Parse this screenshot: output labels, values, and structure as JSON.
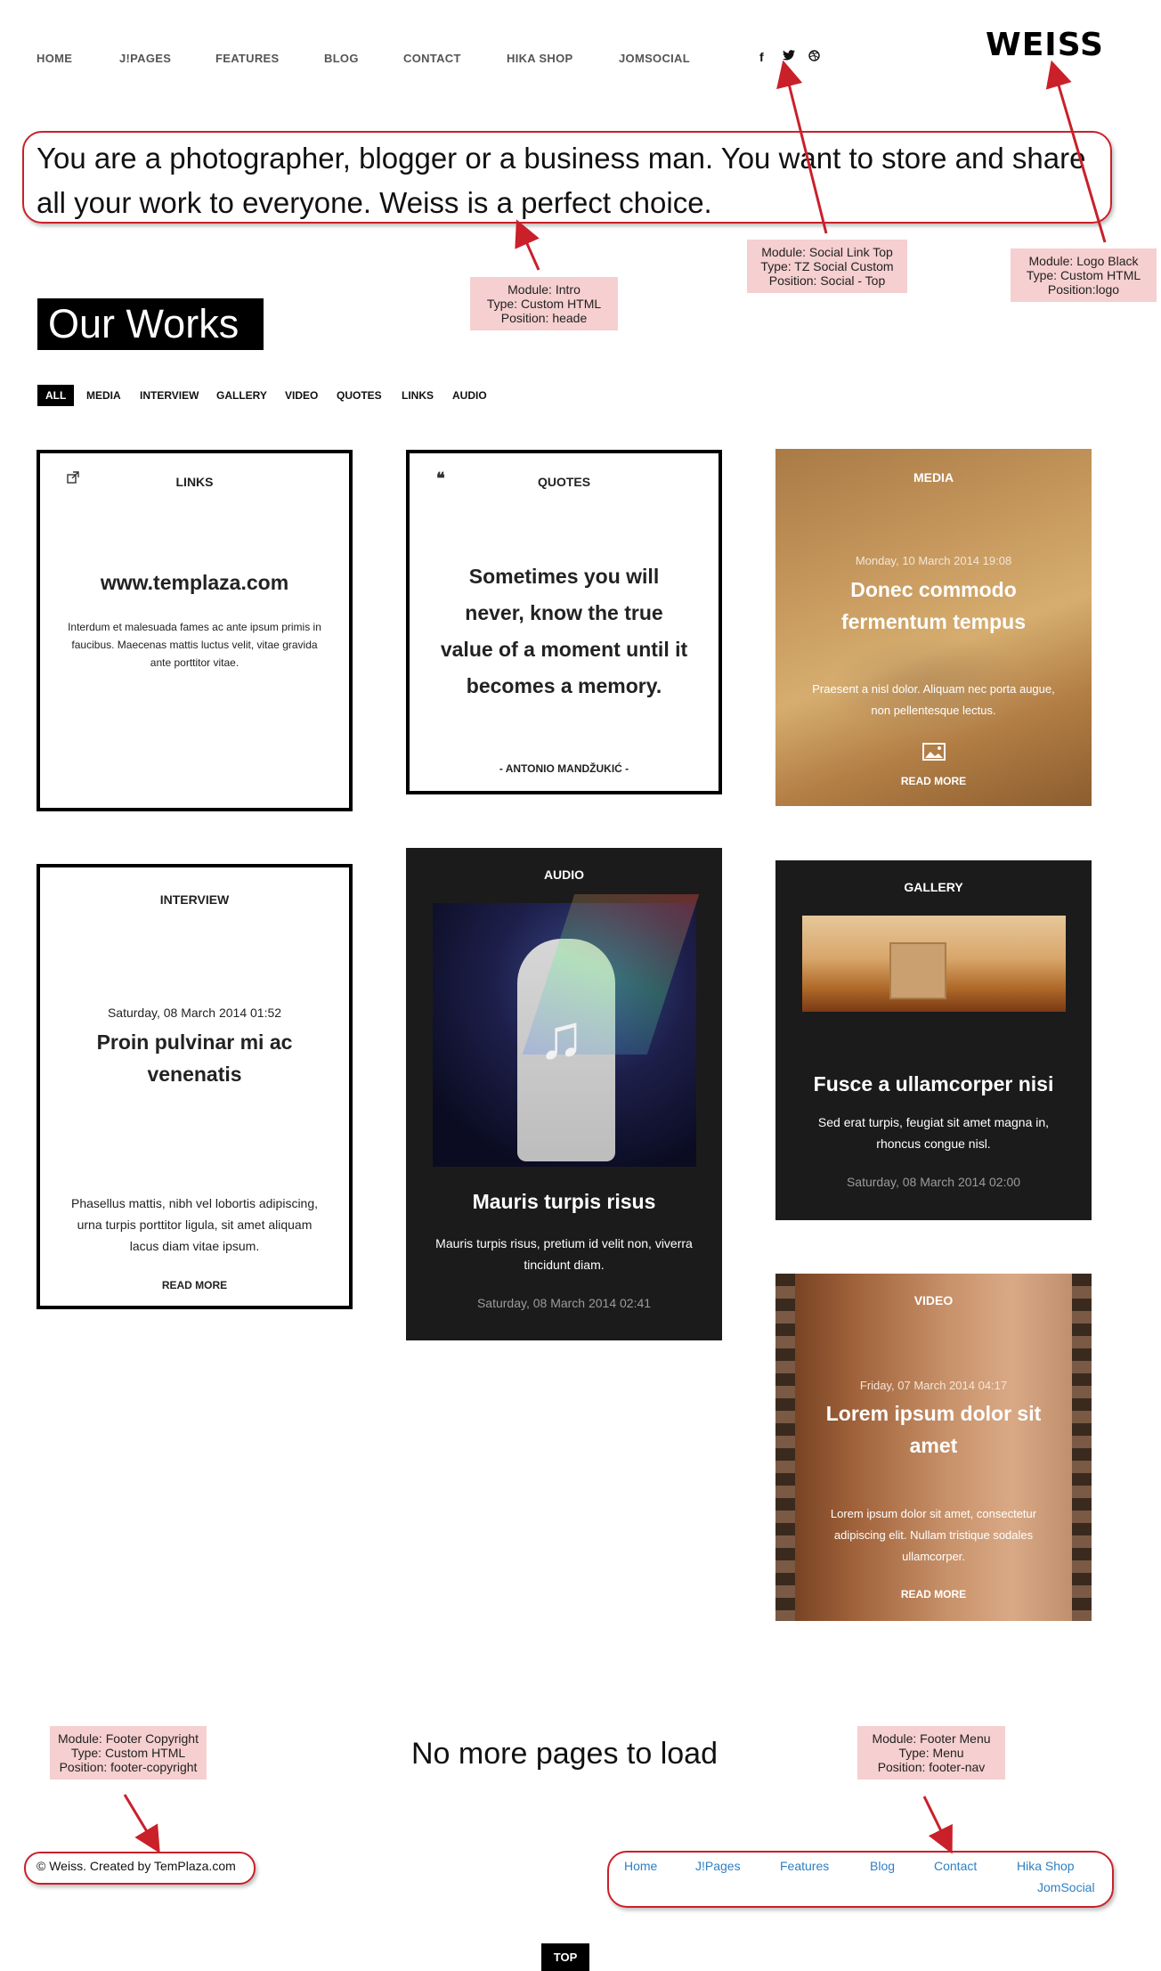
{
  "nav": {
    "items": [
      "HOME",
      "J!PAGES",
      "FEATURES",
      "BLOG",
      "CONTACT",
      "HIKA SHOP",
      "JOMSOCIAL"
    ]
  },
  "social": {
    "facebook": "f",
    "twitter": "🐦",
    "dribbble": "◎"
  },
  "logo": "WEISS",
  "intro": {
    "text": "You are a photographer, blogger or a business man. You want to store and share all your work to everyone. Weiss is a perfect choice."
  },
  "annotations": {
    "intro": [
      "Module: Intro",
      "Type: Custom HTML",
      "Position: heade"
    ],
    "social": [
      "Module: Social Link Top",
      "Type: TZ Social Custom",
      "Position: Social - Top"
    ],
    "logo": [
      "Module: Logo Black",
      "Type: Custom HTML",
      "Position:logo"
    ],
    "footer_copyright": [
      "Module: Footer Copyright",
      "Type: Custom HTML",
      "Position: footer-copyright"
    ],
    "footer_menu": [
      "Module: Footer Menu",
      "Type: Menu",
      "Position: footer-nav"
    ]
  },
  "works": {
    "title": "Our Works",
    "filters": [
      "ALL",
      "MEDIA",
      "INTERVIEW",
      "GALLERY",
      "VIDEO",
      "QUOTES",
      "LINKS",
      "AUDIO"
    ]
  },
  "cards": {
    "links": {
      "label": "LINKS",
      "url": "www.templaza.com",
      "text": "Interdum et malesuada fames ac ante ipsum primis in faucibus. Maecenas mattis luctus velit, vitae gravida ante porttitor vitae."
    },
    "quotes": {
      "label": "QUOTES",
      "quote": "Sometimes you will never, know the true value of a moment until it becomes a memory.",
      "author": "- ANTONIO MANDŽUKIĆ -"
    },
    "media": {
      "label": "MEDIA",
      "date": "Monday, 10 March 2014 19:08",
      "title": "Donec commodo fermentum tempus",
      "text": "Praesent a nisl dolor. Aliquam nec porta augue, non pellentesque lectus.",
      "readmore": "READ MORE"
    },
    "interview": {
      "label": "INTERVIEW",
      "date": "Saturday, 08 March 2014 01:52",
      "title": "Proin pulvinar mi ac venenatis",
      "text": "Phasellus mattis, nibh vel lobortis adipiscing, urna turpis porttitor ligula, sit amet aliquam lacus diam vitae ipsum.",
      "readmore": "READ MORE"
    },
    "audio": {
      "label": "AUDIO",
      "title": "Mauris turpis risus",
      "text": "Mauris turpis risus, pretium id velit non, viverra tincidunt diam.",
      "date": "Saturday, 08 March 2014 02:41"
    },
    "gallery": {
      "label": "GALLERY",
      "title": "Fusce a ullamcorper nisi",
      "text": "Sed erat turpis, feugiat sit amet magna in, rhoncus congue nisl.",
      "date": "Saturday, 08 March 2014 02:00"
    },
    "video": {
      "label": "VIDEO",
      "date": "Friday, 07 March 2014 04:17",
      "title": "Lorem ipsum dolor sit amet",
      "text": "Lorem ipsum dolor sit amet, consectetur adipiscing elit. Nullam tristique sodales ullamcorper.",
      "readmore": "READ MORE"
    }
  },
  "footer": {
    "nomore": "No more pages to load",
    "copyright": "© Weiss. Created by TemPlaza.com",
    "menu": [
      "Home",
      "J!Pages",
      "Features",
      "Blog",
      "Contact",
      "Hika Shop",
      "JomSocial"
    ],
    "top": "TOP"
  },
  "colors": {
    "accent_red": "#c9202a",
    "note_bg": "#f6cfd0",
    "link_blue": "#2f7fc1",
    "dark_card": "#1b1b1b"
  }
}
